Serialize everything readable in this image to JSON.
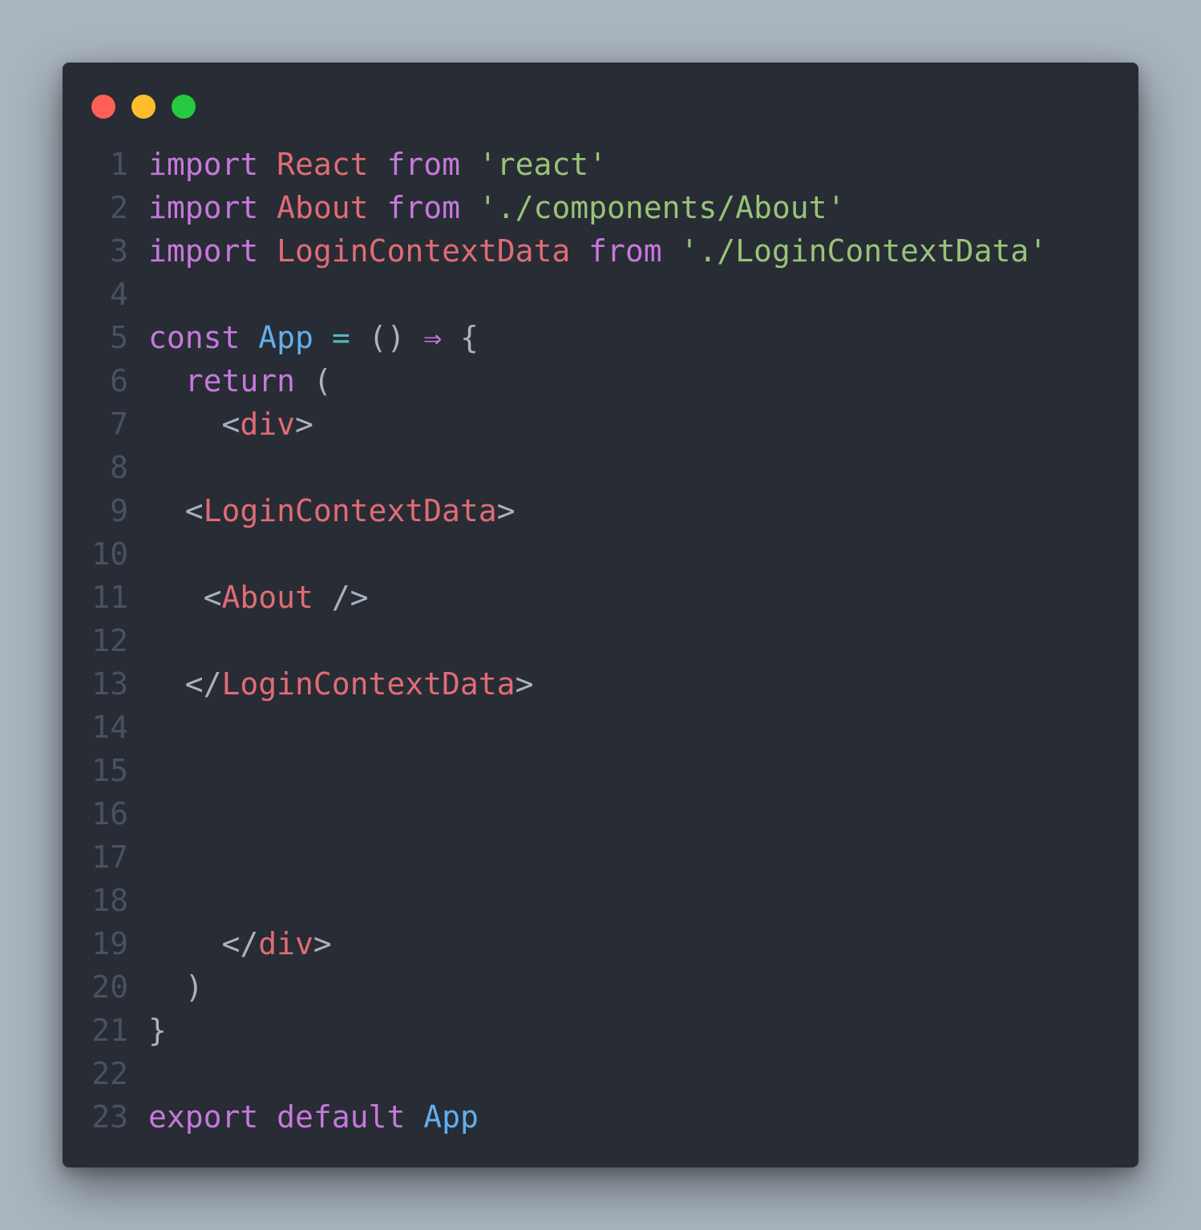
{
  "window": {
    "controls": [
      {
        "name": "close",
        "color": "#ff5f56"
      },
      {
        "name": "minimize",
        "color": "#ffbd2e"
      },
      {
        "name": "maximize",
        "color": "#27c93f"
      }
    ]
  },
  "code": {
    "language": "jsx",
    "lines": [
      [
        {
          "t": "import",
          "c": "kw"
        },
        {
          "t": " ",
          "c": "pun"
        },
        {
          "t": "React",
          "c": "var"
        },
        {
          "t": " ",
          "c": "pun"
        },
        {
          "t": "from",
          "c": "kw"
        },
        {
          "t": " ",
          "c": "pun"
        },
        {
          "t": "'react'",
          "c": "str"
        }
      ],
      [
        {
          "t": "import",
          "c": "kw"
        },
        {
          "t": " ",
          "c": "pun"
        },
        {
          "t": "About",
          "c": "var"
        },
        {
          "t": " ",
          "c": "pun"
        },
        {
          "t": "from",
          "c": "kw"
        },
        {
          "t": " ",
          "c": "pun"
        },
        {
          "t": "'./components/About'",
          "c": "str"
        }
      ],
      [
        {
          "t": "import",
          "c": "kw"
        },
        {
          "t": " ",
          "c": "pun"
        },
        {
          "t": "LoginContextData",
          "c": "var"
        },
        {
          "t": " ",
          "c": "pun"
        },
        {
          "t": "from",
          "c": "kw"
        },
        {
          "t": " ",
          "c": "pun"
        },
        {
          "t": "'./LoginContextData'",
          "c": "str"
        }
      ],
      [],
      [
        {
          "t": "const",
          "c": "kw"
        },
        {
          "t": " ",
          "c": "pun"
        },
        {
          "t": "App",
          "c": "fn"
        },
        {
          "t": " ",
          "c": "pun"
        },
        {
          "t": "=",
          "c": "op"
        },
        {
          "t": " () ",
          "c": "pun"
        },
        {
          "t": "⇒",
          "c": "kw"
        },
        {
          "t": " {",
          "c": "pun"
        }
      ],
      [
        {
          "t": "  ",
          "c": "pun"
        },
        {
          "t": "return",
          "c": "kw"
        },
        {
          "t": " (",
          "c": "pun"
        }
      ],
      [
        {
          "t": "    <",
          "c": "pun"
        },
        {
          "t": "div",
          "c": "var"
        },
        {
          "t": ">",
          "c": "pun"
        }
      ],
      [],
      [
        {
          "t": "  <",
          "c": "pun"
        },
        {
          "t": "LoginContextData",
          "c": "var"
        },
        {
          "t": ">",
          "c": "pun"
        }
      ],
      [],
      [
        {
          "t": "   <",
          "c": "pun"
        },
        {
          "t": "About",
          "c": "var"
        },
        {
          "t": " />",
          "c": "pun"
        }
      ],
      [],
      [
        {
          "t": "  </",
          "c": "pun"
        },
        {
          "t": "LoginContextData",
          "c": "var"
        },
        {
          "t": ">",
          "c": "pun"
        }
      ],
      [],
      [],
      [],
      [],
      [],
      [
        {
          "t": "    </",
          "c": "pun"
        },
        {
          "t": "div",
          "c": "var"
        },
        {
          "t": ">",
          "c": "pun"
        }
      ],
      [
        {
          "t": "  )",
          "c": "pun"
        }
      ],
      [
        {
          "t": "}",
          "c": "pun"
        }
      ],
      [],
      [
        {
          "t": "export",
          "c": "kw"
        },
        {
          "t": " ",
          "c": "pun"
        },
        {
          "t": "default",
          "c": "kw"
        },
        {
          "t": " ",
          "c": "pun"
        },
        {
          "t": "App",
          "c": "fn"
        }
      ]
    ]
  }
}
